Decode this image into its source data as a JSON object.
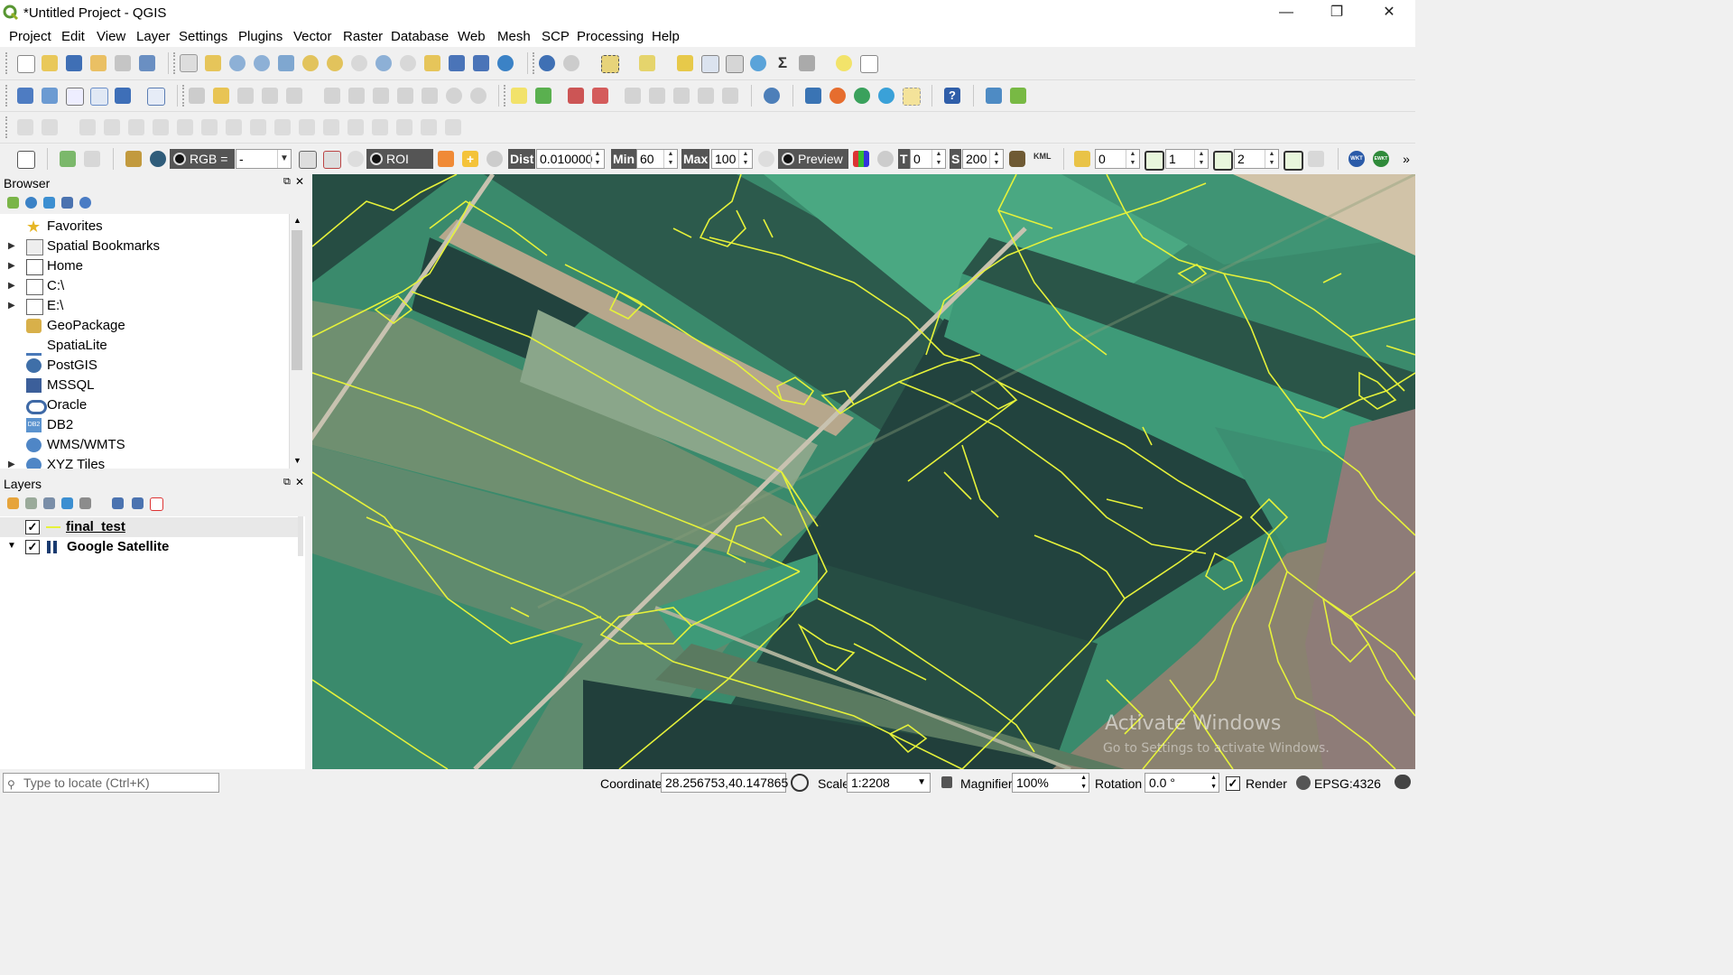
{
  "window": {
    "title": "*Untitled Project - QGIS",
    "minimize": "—",
    "restore": "❐",
    "close": "✕"
  },
  "menu": [
    "Project",
    "Edit",
    "View",
    "Layer",
    "Settings",
    "Plugins",
    "Vector",
    "Raster",
    "Database",
    "Web",
    "Mesh",
    "SCP",
    "Processing",
    "Help"
  ],
  "scp_toolbar": {
    "band_set": "RGB =",
    "band_value": "-",
    "roi_label": "ROI",
    "dist_label": "Dist",
    "dist_value": "0.010000",
    "min_label": "Min",
    "min_value": "60",
    "max_label": "Max",
    "max_value": "100",
    "preview_label": "Preview",
    "t_label": "T",
    "t_value": "0",
    "s_label": "S",
    "s_value": "200",
    "kml_label": "KML",
    "field_1": "0",
    "field_2": "1",
    "field_3": "2",
    "wkt_label": "WKT",
    "ewkt_label": "EWKT",
    "more": "»"
  },
  "browser": {
    "title": "Browser",
    "items": [
      {
        "label": "Favorites",
        "icon": "star-icon",
        "expandable": false
      },
      {
        "label": "Spatial Bookmarks",
        "icon": "bookmark-icon",
        "expandable": true
      },
      {
        "label": "Home",
        "icon": "home-icon",
        "expandable": true
      },
      {
        "label": "C:\\",
        "icon": "folder-icon",
        "expandable": true
      },
      {
        "label": "E:\\",
        "icon": "folder-icon",
        "expandable": true
      },
      {
        "label": "GeoPackage",
        "icon": "geopackage-icon",
        "expandable": false
      },
      {
        "label": "SpatiaLite",
        "icon": "spatialite-icon",
        "expandable": false
      },
      {
        "label": "PostGIS",
        "icon": "postgis-icon",
        "expandable": false
      },
      {
        "label": "MSSQL",
        "icon": "mssql-icon",
        "expandable": false
      },
      {
        "label": "Oracle",
        "icon": "oracle-icon",
        "expandable": false
      },
      {
        "label": "DB2",
        "icon": "db2-icon",
        "expandable": false
      },
      {
        "label": "WMS/WMTS",
        "icon": "globe-icon",
        "expandable": false
      },
      {
        "label": "XYZ Tiles",
        "icon": "globe-icon",
        "expandable": true
      }
    ]
  },
  "layers": {
    "title": "Layers",
    "items": [
      {
        "label": "final_test",
        "checked": true,
        "expanded": false
      },
      {
        "label": "Google Satellite",
        "checked": true,
        "expanded": true
      }
    ]
  },
  "map": {
    "watermark_line1": "Activate Windows",
    "watermark_line2": "Go to Settings to activate Windows."
  },
  "statusbar": {
    "locate_placeholder": "Type to locate (Ctrl+K)",
    "coordinate_label": "Coordinate",
    "coordinate_value": "28.256753,40.147865",
    "scale_label": "Scale",
    "scale_value": "1:2208",
    "magnifier_label": "Magnifier",
    "magnifier_value": "100%",
    "rotation_label": "Rotation",
    "rotation_value": "0.0 °",
    "render_label": "Render",
    "render_checked": true,
    "crs": "EPSG:4326"
  },
  "colors": {
    "vector_line": "#e6f23a",
    "field_dark": "#22433e",
    "field_green": "#3e9a78",
    "field_light": "#4aa882",
    "field_pale": "#7fa88a",
    "bare_soil": "#b6a78c"
  }
}
